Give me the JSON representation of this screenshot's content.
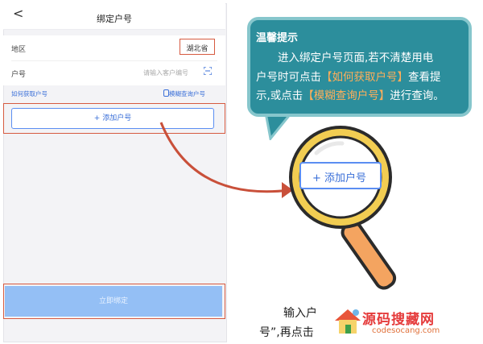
{
  "phone": {
    "back_glyph": "<",
    "title": "绑定户号",
    "region_label": "地区",
    "region_value": "湖北省",
    "account_label": "户号",
    "account_placeholder": "请输入客户编号",
    "how_to_get": "如何获取户号",
    "fuzzy_query": "模糊查询户号",
    "add_account": "+ 添加户号",
    "bind_now": "立即绑定"
  },
  "tip": {
    "title": "温馨提示",
    "line1": "进入绑定户号页面,若不清楚用电",
    "line2_pre": "户号时可点击",
    "line2_hl": "【如何获取户号】",
    "line2_post": "查看提",
    "line3_pre": "示,或点击",
    "line3_hl": "【模糊查询户号】",
    "line3_post": "进行查询。"
  },
  "magnifier_label": "+ 添加户号",
  "caption": {
    "line1": "输入户",
    "line2": "号”,再点击"
  },
  "watermark": {
    "name": "源码搜藏网",
    "url": "codesocang.com"
  },
  "colors": {
    "accent_red": "#d65a40",
    "link_blue": "#3a6fd8",
    "bubble_teal": "#2c8e9c",
    "bind_button": "#94bff5",
    "magnifier_ring": "#f2cd52"
  }
}
